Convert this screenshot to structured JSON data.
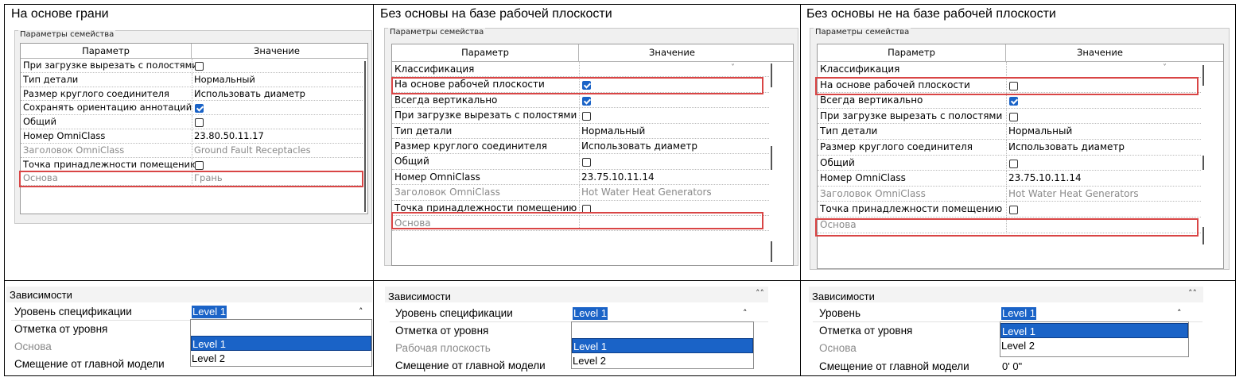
{
  "columns": {
    "c1_title": "На основе грани",
    "c2_title": "Без основы на базе рабочей плоскости",
    "c3_title": "Без основы не на базе рабочей плоскости"
  },
  "family_params": {
    "panel_title": "Параметры семейства",
    "header_param": "Параметр",
    "header_value": "Значение"
  },
  "panel1": {
    "rows": [
      {
        "name": "При загрузке вырезать с полостями",
        "value": "",
        "checkbox": "off"
      },
      {
        "name": "Тип детали",
        "value": "Нормальный"
      },
      {
        "name": "Размер круглого соединителя",
        "value": "Использовать диаметр"
      },
      {
        "name": "Сохранять ориентацию аннотаций",
        "value": "",
        "checkbox": "on"
      },
      {
        "name": "Общий",
        "value": "",
        "checkbox": "off"
      },
      {
        "name": "Номер OmniClass",
        "value": "23.80.50.11.17"
      },
      {
        "name": "Заголовок OmniClass",
        "value": "Ground Fault Receptacles",
        "gray": true
      },
      {
        "name": "Точка принадлежности помещению",
        "value": "",
        "checkbox": "off"
      },
      {
        "name": "Основа",
        "value": "Грань",
        "gray": true
      }
    ]
  },
  "panel2": {
    "rows": [
      {
        "name": "Классификация",
        "value": ""
      },
      {
        "name": "На основе рабочей плоскости",
        "value": "",
        "checkbox": "on"
      },
      {
        "name": "Всегда вертикально",
        "value": "",
        "checkbox": "on"
      },
      {
        "name": "При загрузке вырезать с полостями",
        "value": "",
        "checkbox": "off"
      },
      {
        "name": "Тип детали",
        "value": "Нормальный"
      },
      {
        "name": "Размер круглого соединителя",
        "value": "Использовать диаметр"
      },
      {
        "name": "Общий",
        "value": "",
        "checkbox": "off"
      },
      {
        "name": "Номер OmniClass",
        "value": "23.75.10.11.14"
      },
      {
        "name": "Заголовок OmniClass",
        "value": "Hot Water Heat Generators",
        "gray": true
      },
      {
        "name": "Точка принадлежности помещению",
        "value": "",
        "checkbox": "off"
      },
      {
        "name": "Основа",
        "value": "",
        "gray": true
      }
    ]
  },
  "panel3": {
    "rows": [
      {
        "name": "Классификация",
        "value": ""
      },
      {
        "name": "На основе рабочей плоскости",
        "value": "",
        "checkbox": "off"
      },
      {
        "name": "Всегда вертикально",
        "value": "",
        "checkbox": "on"
      },
      {
        "name": "При загрузке вырезать с полостями",
        "value": "",
        "checkbox": "off"
      },
      {
        "name": "Тип детали",
        "value": "Нормальный"
      },
      {
        "name": "Размер круглого соединителя",
        "value": "Использовать диаметр"
      },
      {
        "name": "Общий",
        "value": "",
        "checkbox": "off"
      },
      {
        "name": "Номер OmniClass",
        "value": "23.75.10.11.14"
      },
      {
        "name": "Заголовок OmniClass",
        "value": "Hot Water Heat Generators",
        "gray": true
      },
      {
        "name": "Точка принадлежности помещению",
        "value": "",
        "checkbox": "off"
      },
      {
        "name": "Основа",
        "value": "",
        "gray": true
      }
    ]
  },
  "constraints": {
    "section": "Зависимости",
    "p1": {
      "level_label": "Уровень спецификации",
      "offset_label": "Отметка от уровня",
      "host_label": "Основа",
      "host_offset_label": "Смещение от главной модели",
      "selected": "Level 1",
      "options": [
        "Level 1",
        "Level 2"
      ]
    },
    "p2": {
      "level_label": "Уровень спецификации",
      "offset_label": "Отметка от уровня",
      "host_label": "Рабочая плоскость",
      "host_offset_label": "Смещение от главной модели",
      "selected": "Level 1",
      "options": [
        "Level 1",
        "Level 2"
      ]
    },
    "p3": {
      "level_label": "Уровень",
      "offset_label": "Отметка от уровня",
      "host_label": "Основа",
      "host_offset_label": "Смещение от главной модели",
      "host_offset_value": "0'  0\"",
      "selected": "Level 1",
      "options": [
        "Level 1",
        "Level 2"
      ]
    }
  },
  "icons": {
    "collapse": "double-chevron-up-icon",
    "dropdown_caret": "caret-up-icon",
    "checkbox_on": "checkbox-checked-icon",
    "checkbox_off": "checkbox-unchecked-icon"
  },
  "colors": {
    "highlight": "#d94545",
    "selection": "#1a63c7"
  }
}
